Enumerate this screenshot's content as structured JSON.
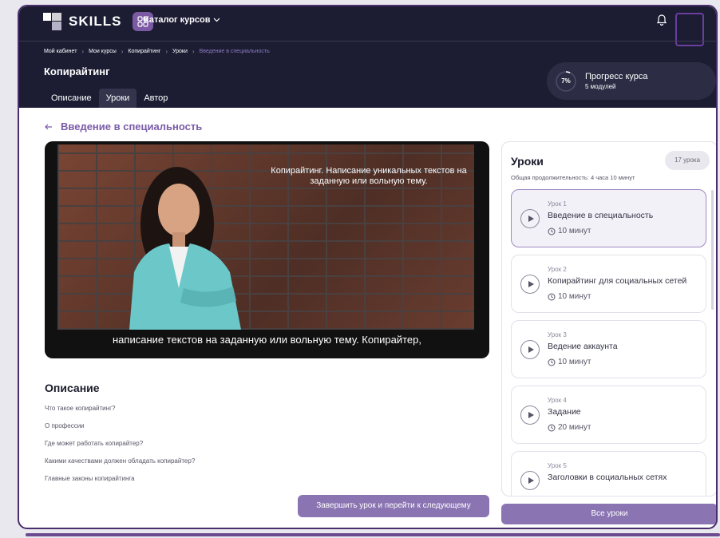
{
  "header": {
    "logo_text": "SKILLS",
    "catalog_label": "Каталог курсов"
  },
  "breadcrumb": [
    "Мой кабинет",
    "Мои курсы",
    "Копирайтинг",
    "Уроки",
    "Введение в специальность"
  ],
  "course": {
    "title": "Копирайтинг",
    "tabs": [
      "Описание",
      "Уроки",
      "Автор"
    ],
    "active_tab": "Уроки"
  },
  "progress": {
    "percent_label": "7%",
    "percent": 7,
    "title": "Прогресс курса",
    "subtitle": "5 модулей"
  },
  "lesson": {
    "title": "Введение в специальность",
    "video_caption_top": "Копирайтинг. Написание уникальных текстов на заданную или вольную тему.",
    "video_caption_bottom": "написание текстов на заданную или вольную тему. Копирайтер,"
  },
  "description": {
    "title": "Описание",
    "items": [
      "Что такое копирайтинг?",
      "О профессии",
      "Где может работать копирайтер?",
      "Какими качествами должен обладать копирайтер?",
      "Главные законы копирайтинга"
    ]
  },
  "finish_button": "Завершить урок и перейти к следующему",
  "lessons": {
    "title": "Уроки",
    "count": "17 урока",
    "duration": "Общая продолжительность: 4 часа 10 минут",
    "items": [
      {
        "num": "Урок 1",
        "name": "Введение в специальность",
        "time": "10 минут"
      },
      {
        "num": "Урок 2",
        "name": "Копирайтинг для социальных сетей",
        "time": "10 минут"
      },
      {
        "num": "Урок 3",
        "name": "Ведение аккаунта",
        "time": "10 минут"
      },
      {
        "num": "Урок 4",
        "name": "Задание",
        "time": "20 минут"
      },
      {
        "num": "Урок 5",
        "name": "Заголовки в социальных сетях",
        "time": ""
      }
    ],
    "all_button": "Все уроки"
  },
  "colors": {
    "header_bg": "#1c1d33",
    "accent": "#8a74b2",
    "accent_text": "#7a5ba8"
  }
}
